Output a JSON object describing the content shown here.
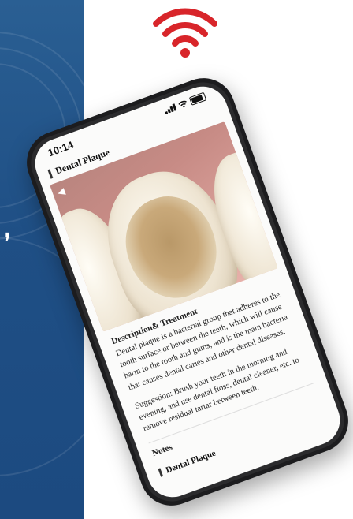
{
  "status_bar": {
    "time": "10:14"
  },
  "header": {
    "title": "Dental Plaque"
  },
  "description": {
    "heading": "Description& Treatment",
    "body": "Dental plaque is a bacterial group that adheres to the tooth surface or between the teeth, which will cause harm to the tooth and gums, and is the main bacteria that causes dental caries and other dental diseases."
  },
  "suggestion": {
    "body": "Suggestion: Brush your teeth in the morning and evening, and use dental floss, dental cleaner, etc. to remove residual tartar between teeth."
  },
  "notes": {
    "label": "Notes"
  },
  "next_item": {
    "title": "Dental Plaque"
  },
  "colors": {
    "panel_blue": "#1f4f85",
    "wifi_red": "#d8252a"
  },
  "icons": [
    "wifi-icon",
    "signal-icon",
    "wifi-status-icon",
    "battery-icon",
    "back-arrow-icon"
  ]
}
